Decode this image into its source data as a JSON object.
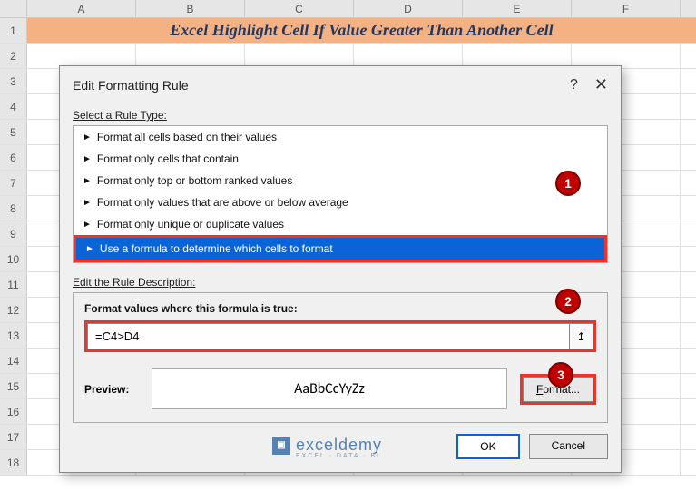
{
  "columns": [
    "A",
    "B",
    "C",
    "D",
    "E",
    "F"
  ],
  "rows": [
    "1",
    "2",
    "3",
    "4",
    "5",
    "6",
    "7",
    "8",
    "9",
    "10",
    "11",
    "12",
    "13",
    "14",
    "15",
    "16",
    "17",
    "18"
  ],
  "title": "Excel Highlight Cell If Value Greater Than Another Cell",
  "dialog": {
    "title": "Edit Formatting Rule",
    "help": "?",
    "close": "✕",
    "select_label": "Select a Rule Type:",
    "rules": [
      "Format all cells based on their values",
      "Format only cells that contain",
      "Format only top or bottom ranked values",
      "Format only values that are above or below average",
      "Format only unique or duplicate values",
      "Use a formula to determine which cells to format"
    ],
    "edit_label": "Edit the Rule Description:",
    "formula_label": "Format values where this formula is true:",
    "formula_value": "=C4>D4",
    "preview_label": "Preview:",
    "preview_text": "AaBbCcYyZz",
    "format_btn_pre": "F",
    "format_btn_post": "ormat...",
    "ok": "OK",
    "cancel": "Cancel"
  },
  "callouts": {
    "c1": "1",
    "c2": "2",
    "c3": "3"
  },
  "watermark": {
    "name": "exceldemy",
    "sub": "EXCEL · DATA · BI"
  }
}
